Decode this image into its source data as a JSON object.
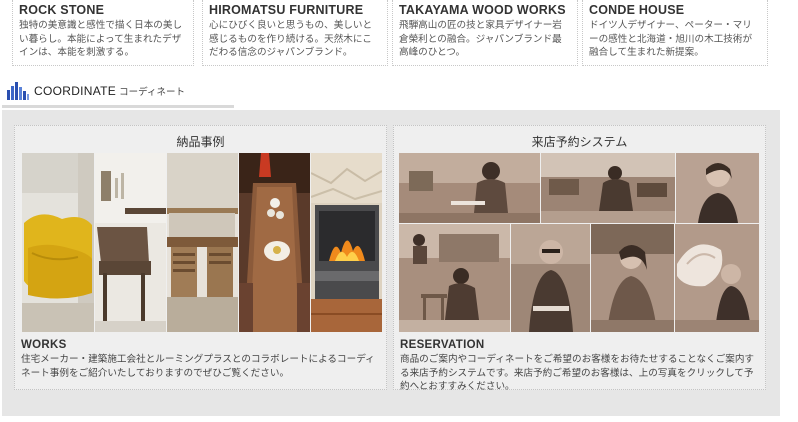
{
  "brands": [
    {
      "name": "ROCK STONE",
      "desc": "独特の美意識と感性で描く日本の美しい暮らし。本能によって生まれたデザインは、本能を刺激する。"
    },
    {
      "name": "HIROMATSU FURNITURE",
      "desc": "心にひびく良いと思うもの、美しいと感じるものを作り続ける。天然木にこだわる信念のジャパンブランド。"
    },
    {
      "name": "TAKAYAMA WOOD WORKS",
      "desc": "飛騨高山の匠の技と家具デザイナー岩倉榮利との融合。ジャパンブランド最高峰のひとつ。"
    },
    {
      "name": "CONDE HOUSE",
      "desc": "ドイツ人デザイナー、ペーター・マリーの感性と北海道・旭川の木工技術が融合して生まれた新提案。"
    }
  ],
  "coordinate": {
    "title": "COORDINATE",
    "subtitle": "コーディネート"
  },
  "works": {
    "heading": "納品事例",
    "title": "WORKS",
    "desc": "住宅メーカー・建築施工会社とルーミングプラスとのコラボレートによるコーディネート事例をご紹介いたしておりますのでぜひご覧ください。"
  },
  "reservation": {
    "heading": "来店予約システム",
    "title": "RESERVATION",
    "desc": "商品のご案内やコーディネートをご希望のお客様をお待たせすることなくご案内する来店予約システムです。来店予約ご希望のお客様は、上の写真をクリックして予約へとおすすみください。"
  },
  "colors": {
    "accent_icon": "#2a4fb0",
    "panel_bg": "#efefef",
    "sepia": "#8a6d5c"
  }
}
